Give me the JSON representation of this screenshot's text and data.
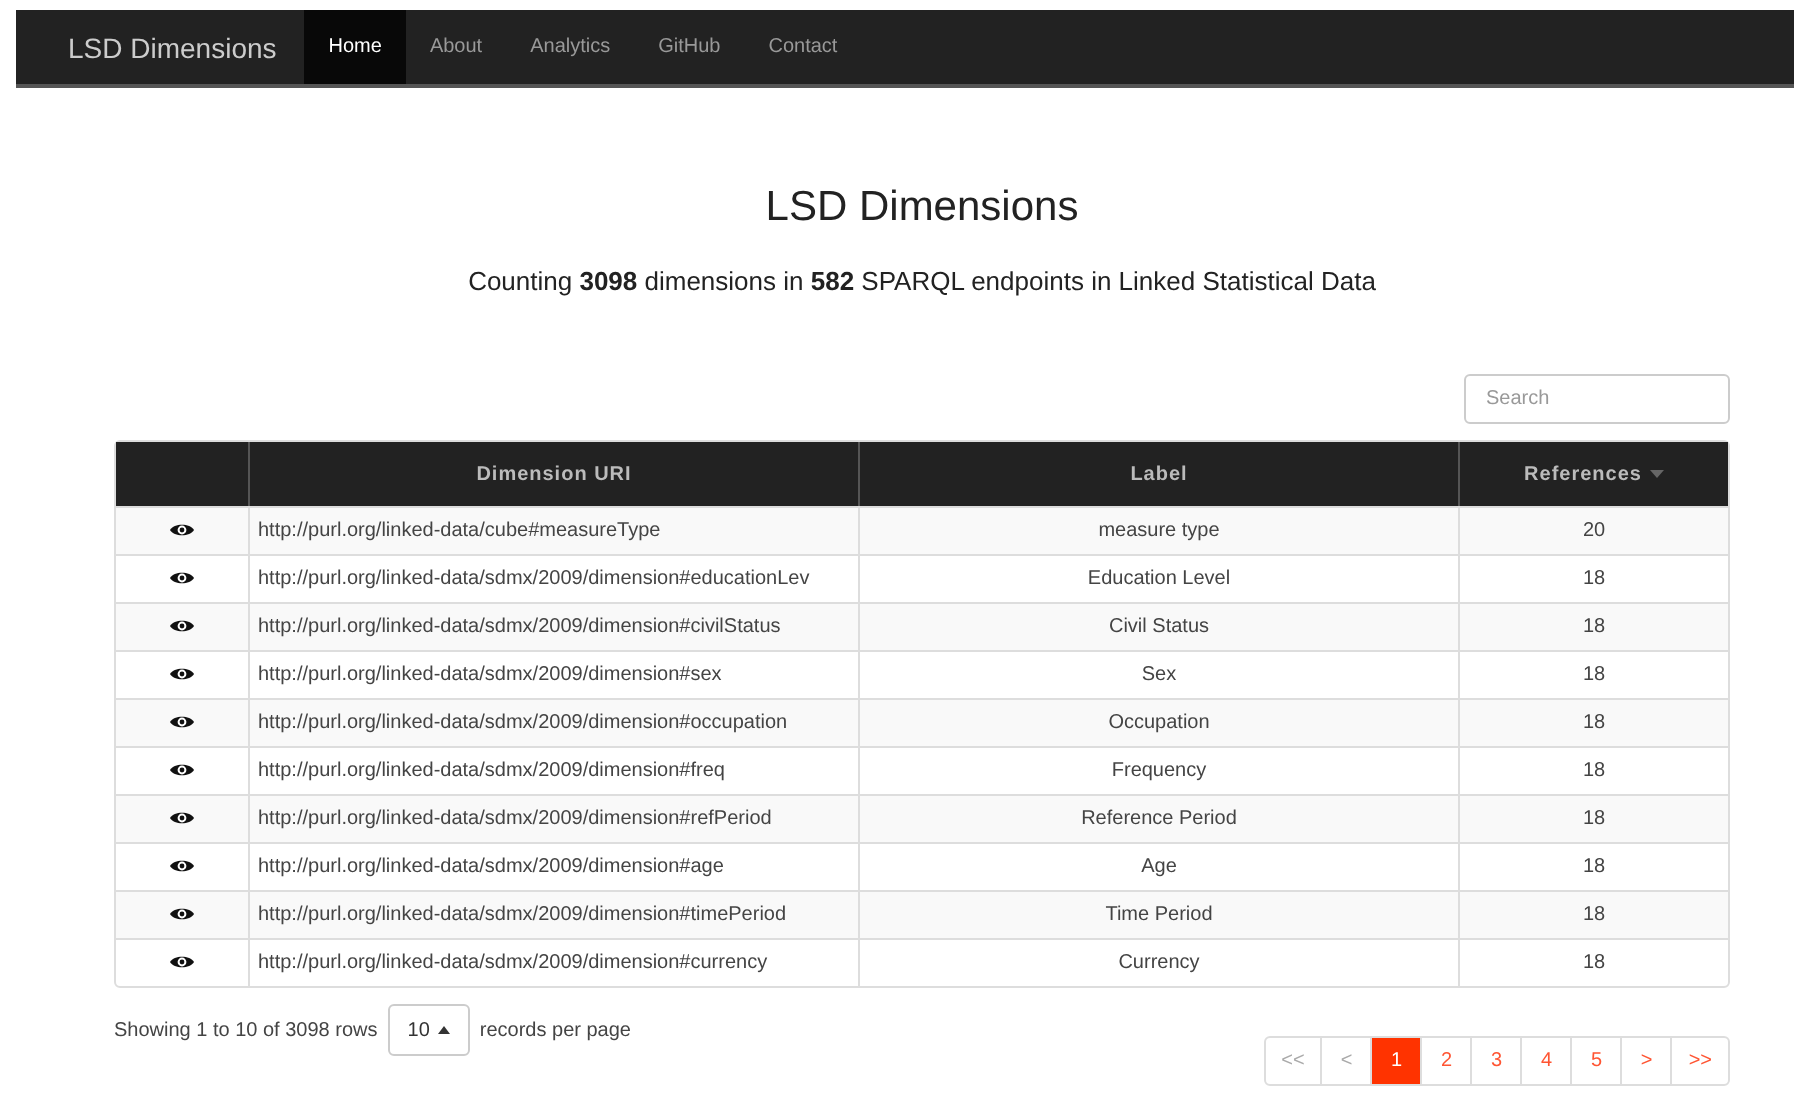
{
  "navbar": {
    "brand": "LSD Dimensions",
    "items": [
      {
        "label": "Home",
        "selected": true
      },
      {
        "label": "About",
        "selected": false
      },
      {
        "label": "Analytics",
        "selected": false
      },
      {
        "label": "GitHub",
        "selected": false
      },
      {
        "label": "Contact",
        "selected": false
      }
    ]
  },
  "heading": "LSD Dimensions",
  "subtitle": "Counting **3098** dimensions in **582** SPARQL endpoints in Linked Statistical Data",
  "search": {
    "placeholder": "Search"
  },
  "table": {
    "columns": [
      {
        "label": "Dimension URI",
        "sorted": false
      },
      {
        "label": "Label",
        "sorted": false
      },
      {
        "label": "References",
        "sorted": true
      }
    ],
    "rows": [
      {
        "uri": "http://purl.org/linked-data/cube#measureType",
        "label": "measure type",
        "references": "20"
      },
      {
        "uri": "http://purl.org/linked-data/sdmx/2009/dimension#educationLev",
        "label": "Education Level",
        "references": "18"
      },
      {
        "uri": "http://purl.org/linked-data/sdmx/2009/dimension#civilStatus",
        "label": "Civil Status",
        "references": "18"
      },
      {
        "uri": "http://purl.org/linked-data/sdmx/2009/dimension#sex",
        "label": "Sex",
        "references": "18"
      },
      {
        "uri": "http://purl.org/linked-data/sdmx/2009/dimension#occupation",
        "label": "Occupation",
        "references": "18"
      },
      {
        "uri": "http://purl.org/linked-data/sdmx/2009/dimension#freq",
        "label": "Frequency",
        "references": "18"
      },
      {
        "uri": "http://purl.org/linked-data/sdmx/2009/dimension#refPeriod",
        "label": "Reference Period",
        "references": "18"
      },
      {
        "uri": "http://purl.org/linked-data/sdmx/2009/dimension#age",
        "label": "Age",
        "references": "18"
      },
      {
        "uri": "http://purl.org/linked-data/sdmx/2009/dimension#timePeriod",
        "label": "Time Period",
        "references": "18"
      },
      {
        "uri": "http://purl.org/linked-data/sdmx/2009/dimension#currency",
        "label": "Currency",
        "references": "18"
      }
    ]
  },
  "footer": {
    "showing": "Showing 1 to 10 of 3098 rows",
    "page_size": "10",
    "per_page": "records per page"
  },
  "pagination": [
    {
      "label": "<<",
      "selected": false,
      "disabled": true
    },
    {
      "label": "<",
      "selected": false,
      "disabled": true
    },
    {
      "label": "1",
      "selected": true,
      "disabled": false
    },
    {
      "label": "2",
      "selected": false,
      "disabled": false
    },
    {
      "label": "3",
      "selected": false,
      "disabled": false
    },
    {
      "label": "4",
      "selected": false,
      "disabled": false
    },
    {
      "label": "5",
      "selected": false,
      "disabled": false
    },
    {
      "label": ">",
      "selected": false,
      "disabled": false
    },
    {
      "label": ">>",
      "selected": false,
      "disabled": false
    }
  ]
}
